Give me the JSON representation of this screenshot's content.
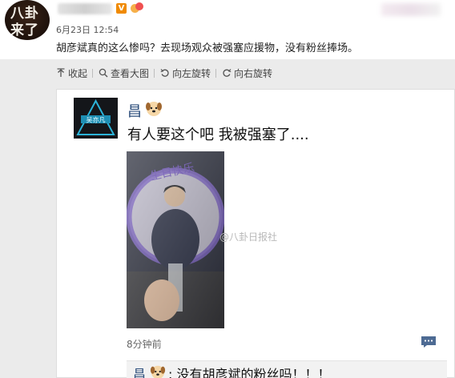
{
  "post": {
    "avatar_text_line1": "八卦",
    "avatar_text_line2": "来了",
    "verified_badge": "V",
    "time": "6月23日 12:54",
    "caption": "胡彦斌真的这么惨吗？去现场观众被强塞应援物，没有粉丝捧场。"
  },
  "toolbar": {
    "items": [
      {
        "label": "收起",
        "icon": "collapse-arrow-icon"
      },
      {
        "label": "查看大图",
        "icon": "magnifier-icon"
      },
      {
        "label": "向左旋转",
        "icon": "rotate-left-icon"
      },
      {
        "label": "向右旋转",
        "icon": "rotate-right-icon"
      }
    ]
  },
  "screenshot": {
    "name": "昌",
    "text": "有人要这个吧 我被强塞了....",
    "watermark": "@八卦日报社",
    "time_ago": "8分钟前",
    "reply_name": "昌",
    "reply_text": ": 没有胡彦斌的粉丝吗！！！",
    "photo_sign_text": "生日快乐"
  },
  "colors": {
    "link_blue": "#2e4f7c",
    "grey_bg": "#ebebeb",
    "badge_orange": "#f08a00"
  }
}
